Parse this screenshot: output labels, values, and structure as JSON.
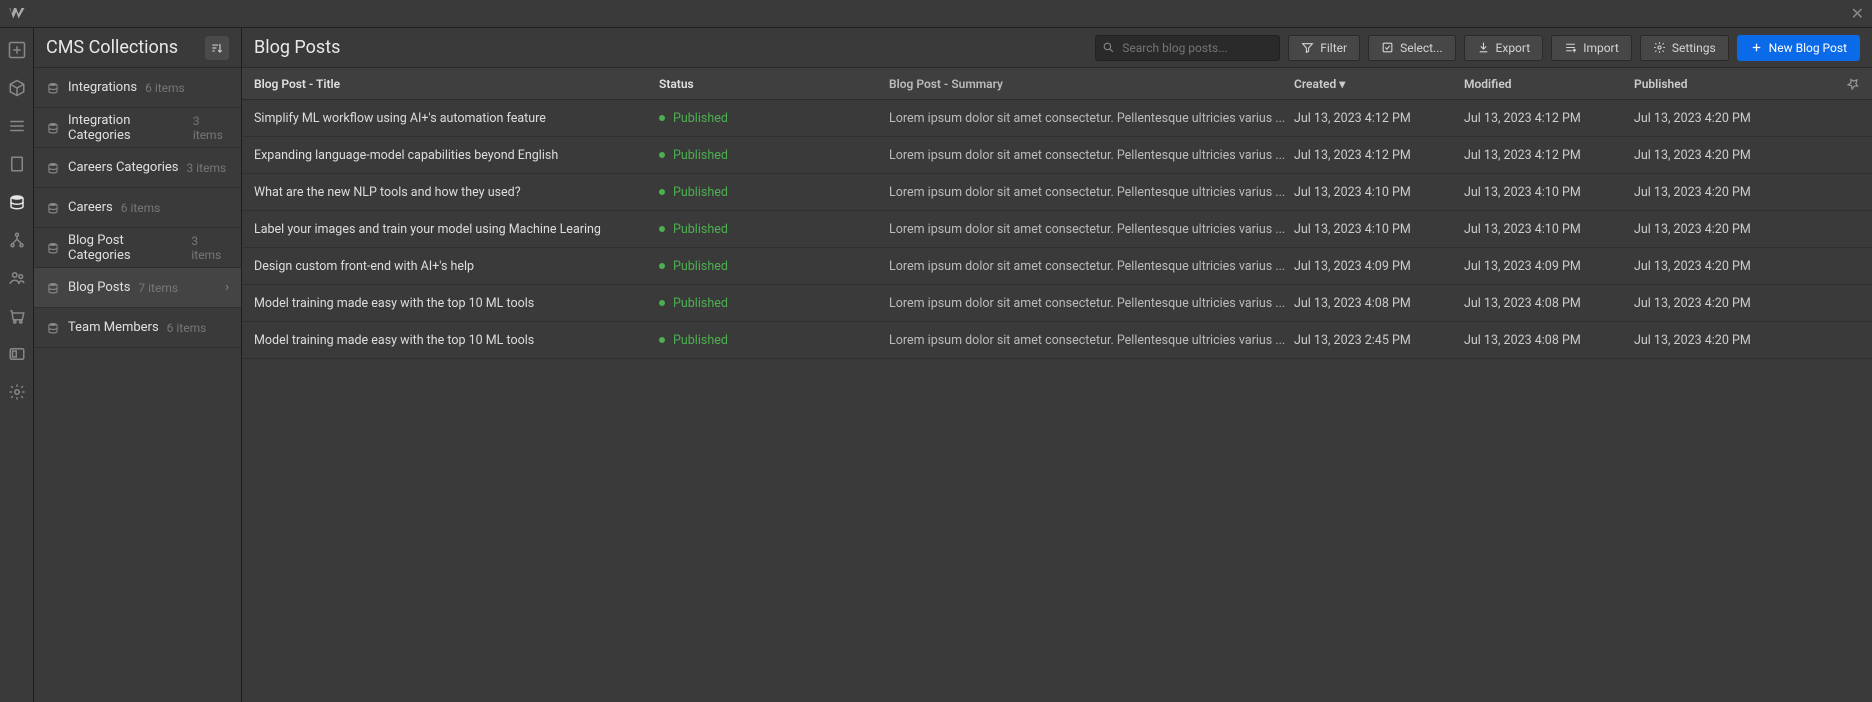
{
  "header": {
    "collections_title": "CMS Collections",
    "main_title": "Blog Posts"
  },
  "search": {
    "placeholder": "Search blog posts..."
  },
  "toolbar": {
    "filter": "Filter",
    "select": "Select...",
    "export": "Export",
    "import": "Import",
    "settings": "Settings",
    "new": "New Blog Post"
  },
  "collections": [
    {
      "name": "Integrations",
      "count": "6 items"
    },
    {
      "name": "Integration Categories",
      "count": "3 items"
    },
    {
      "name": "Careers Categories",
      "count": "3 items"
    },
    {
      "name": "Careers",
      "count": "6 items"
    },
    {
      "name": "Blog Post Categories",
      "count": "3 items"
    },
    {
      "name": "Blog Posts",
      "count": "7 items",
      "active": true
    },
    {
      "name": "Team Members",
      "count": "6 items"
    }
  ],
  "table": {
    "headers": {
      "title": "Blog Post - Title",
      "status": "Status",
      "summary": "Blog Post - Summary",
      "created": "Created",
      "modified": "Modified",
      "published": "Published"
    },
    "rows": [
      {
        "title": "Simplify ML workflow using AI+'s automation feature",
        "status": "Published",
        "summary": "Lorem ipsum dolor sit amet consectetur. Pellentesque ultricies varius ...",
        "created": "Jul 13, 2023 4:12 PM",
        "modified": "Jul 13, 2023 4:12 PM",
        "published": "Jul 13, 2023 4:20 PM"
      },
      {
        "title": "Expanding language-model capabilities beyond English",
        "status": "Published",
        "summary": "Lorem ipsum dolor sit amet consectetur. Pellentesque ultricies varius ...",
        "created": "Jul 13, 2023 4:12 PM",
        "modified": "Jul 13, 2023 4:12 PM",
        "published": "Jul 13, 2023 4:20 PM"
      },
      {
        "title": "What are the new NLP tools and how they used?",
        "status": "Published",
        "summary": "Lorem ipsum dolor sit amet consectetur. Pellentesque ultricies varius ...",
        "created": "Jul 13, 2023 4:10 PM",
        "modified": "Jul 13, 2023 4:10 PM",
        "published": "Jul 13, 2023 4:20 PM"
      },
      {
        "title": "Label your images and train your model using Machine Learing",
        "status": "Published",
        "summary": "Lorem ipsum dolor sit amet consectetur. Pellentesque ultricies varius ...",
        "created": "Jul 13, 2023 4:10 PM",
        "modified": "Jul 13, 2023 4:10 PM",
        "published": "Jul 13, 2023 4:20 PM"
      },
      {
        "title": "Design custom front-end with AI+'s help",
        "status": "Published",
        "summary": "Lorem ipsum dolor sit amet consectetur. Pellentesque ultricies varius ...",
        "created": "Jul 13, 2023 4:09 PM",
        "modified": "Jul 13, 2023 4:09 PM",
        "published": "Jul 13, 2023 4:20 PM"
      },
      {
        "title": "Model training made easy with the top 10 ML tools",
        "status": "Published",
        "summary": "Lorem ipsum dolor sit amet consectetur. Pellentesque ultricies varius ...",
        "created": "Jul 13, 2023 4:08 PM",
        "modified": "Jul 13, 2023 4:08 PM",
        "published": "Jul 13, 2023 4:20 PM"
      },
      {
        "title": "Model training made easy with the top 10 ML tools",
        "status": "Published",
        "summary": "Lorem ipsum dolor sit amet consectetur. Pellentesque ultricies varius ...",
        "created": "Jul 13, 2023 2:45 PM",
        "modified": "Jul 13, 2023 4:08 PM",
        "published": "Jul 13, 2023 4:20 PM"
      }
    ]
  }
}
